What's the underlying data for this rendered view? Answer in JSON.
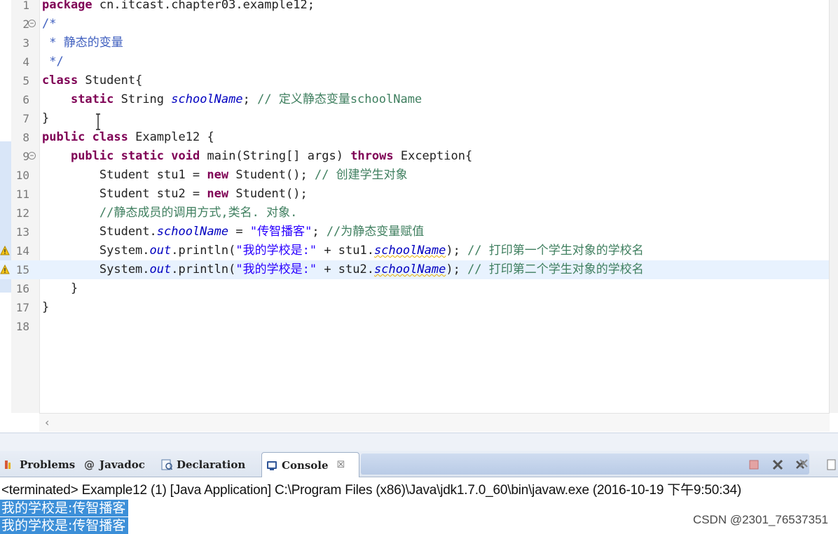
{
  "editor": {
    "lines": [
      {
        "n": "1",
        "parts": [
          {
            "c": "kw",
            "t": "package"
          },
          {
            "c": "",
            "t": " cn.itcast.chapter03.example12;"
          }
        ]
      },
      {
        "n": "2",
        "fold": "⊖",
        "parts": [
          {
            "c": "cmd",
            "t": "/*"
          }
        ]
      },
      {
        "n": "3",
        "parts": [
          {
            "c": "cmd",
            "t": " * 静态的变量"
          }
        ]
      },
      {
        "n": "4",
        "parts": [
          {
            "c": "cmd",
            "t": " */"
          }
        ]
      },
      {
        "n": "5",
        "parts": [
          {
            "c": "kw",
            "t": "class"
          },
          {
            "c": "",
            "t": " Student{"
          }
        ]
      },
      {
        "n": "6",
        "parts": [
          {
            "c": "",
            "t": "    "
          },
          {
            "c": "kw",
            "t": "static"
          },
          {
            "c": "",
            "t": " String "
          },
          {
            "c": "fld",
            "t": "schoolName"
          },
          {
            "c": "",
            "t": "; "
          },
          {
            "c": "cm",
            "t": "// 定义静态变量schoolName"
          }
        ]
      },
      {
        "n": "7",
        "parts": [
          {
            "c": "",
            "t": "}"
          }
        ]
      },
      {
        "n": "8",
        "parts": [
          {
            "c": "kw",
            "t": "public"
          },
          {
            "c": "",
            "t": " "
          },
          {
            "c": "kw",
            "t": "class"
          },
          {
            "c": "",
            "t": " Example12 {"
          }
        ]
      },
      {
        "n": "9",
        "fold": "⊖",
        "parts": [
          {
            "c": "",
            "t": "    "
          },
          {
            "c": "kw",
            "t": "public"
          },
          {
            "c": "",
            "t": " "
          },
          {
            "c": "kw",
            "t": "static"
          },
          {
            "c": "",
            "t": " "
          },
          {
            "c": "kw",
            "t": "void"
          },
          {
            "c": "",
            "t": " main(String[] args) "
          },
          {
            "c": "kw",
            "t": "throws"
          },
          {
            "c": "",
            "t": " Exception{"
          }
        ]
      },
      {
        "n": "10",
        "parts": [
          {
            "c": "",
            "t": "        Student stu1 = "
          },
          {
            "c": "kw",
            "t": "new"
          },
          {
            "c": "",
            "t": " Student(); "
          },
          {
            "c": "cm",
            "t": "// 创建学生对象"
          }
        ]
      },
      {
        "n": "11",
        "parts": [
          {
            "c": "",
            "t": "        Student stu2 = "
          },
          {
            "c": "kw",
            "t": "new"
          },
          {
            "c": "",
            "t": " Student();"
          }
        ]
      },
      {
        "n": "12",
        "parts": [
          {
            "c": "",
            "t": "        "
          },
          {
            "c": "cm",
            "t": "//静态成员的调用方式,类名. 对象."
          }
        ]
      },
      {
        "n": "13",
        "parts": [
          {
            "c": "",
            "t": "        Student."
          },
          {
            "c": "fld",
            "t": "schoolName"
          },
          {
            "c": "",
            "t": " = "
          },
          {
            "c": "st",
            "t": "\"传智播客\""
          },
          {
            "c": "",
            "t": "; "
          },
          {
            "c": "cm",
            "t": "//为静态变量赋值"
          }
        ]
      },
      {
        "n": "14",
        "warn": true,
        "parts": [
          {
            "c": "",
            "t": "        System."
          },
          {
            "c": "fld",
            "t": "out"
          },
          {
            "c": "",
            "t": ".println("
          },
          {
            "c": "st",
            "t": "\"我的学校是:\""
          },
          {
            "c": "",
            "t": " + stu1."
          },
          {
            "c": "fld warnline",
            "t": "schoolName"
          },
          {
            "c": "",
            "t": "); "
          },
          {
            "c": "cm",
            "t": "// 打印第一个学生对象的学校名"
          }
        ]
      },
      {
        "n": "15",
        "warn": true,
        "current": true,
        "parts": [
          {
            "c": "",
            "t": "        System."
          },
          {
            "c": "fld",
            "t": "out"
          },
          {
            "c": "",
            "t": ".println("
          },
          {
            "c": "st",
            "t": "\"我的学校是:\""
          },
          {
            "c": "",
            "t": " + stu2."
          },
          {
            "c": "fld warnline",
            "t": "schoolName"
          },
          {
            "c": "",
            "t": "); "
          },
          {
            "c": "cm",
            "t": "// 打印第二个学生对象的学校名"
          }
        ]
      },
      {
        "n": "16",
        "parts": [
          {
            "c": "",
            "t": "    }"
          }
        ]
      },
      {
        "n": "17",
        "parts": [
          {
            "c": "",
            "t": "}"
          }
        ]
      },
      {
        "n": "18",
        "parts": []
      }
    ]
  },
  "tabs": [
    {
      "label": "Problems",
      "icon": "problems-icon"
    },
    {
      "label": "Javadoc",
      "icon": "javadoc-icon"
    },
    {
      "label": "Declaration",
      "icon": "declaration-icon"
    },
    {
      "label": "Console",
      "icon": "console-icon",
      "active": true,
      "close": "☒"
    }
  ],
  "console": {
    "header": "<terminated> Example12 (1) [Java Application] C:\\Program Files (x86)\\Java\\jdk1.7.0_60\\bin\\javaw.exe (2016-10-19 下午9:50:34)",
    "output": [
      "我的学校是:传智播客",
      "我的学校是:传智播客"
    ]
  },
  "watermark": "CSDN @2301_76537351",
  "colors": {
    "keyword": "#7f0055",
    "comment": "#3f7f5f",
    "javadoc": "#3f5fbf",
    "string": "#2a00ff",
    "field": "#0000c0",
    "selection": "#3c8fd8",
    "current_line": "#e8f2fe"
  }
}
